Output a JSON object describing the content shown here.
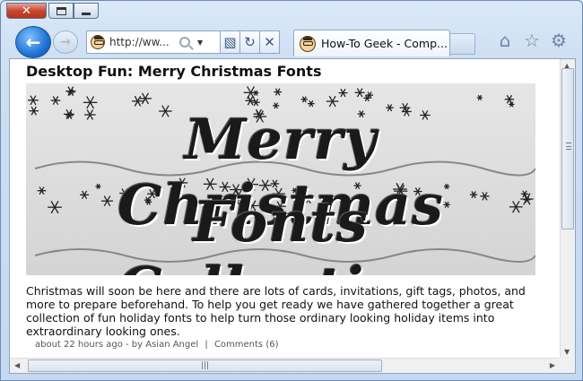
{
  "window": {
    "close_glyph": "✕"
  },
  "nav": {
    "back_glyph": "←",
    "forward_glyph": "→"
  },
  "address": {
    "url": "http://ww..."
  },
  "address_buttons": {
    "compat_glyph": "▧",
    "refresh_glyph": "↻",
    "stop_glyph": "✕",
    "dropdown_glyph": "▼"
  },
  "tab": {
    "title": "How-To Geek - Comp..."
  },
  "tools": {
    "home_glyph": "⌂",
    "favorites_glyph": "☆",
    "settings_glyph": "⚙"
  },
  "article": {
    "title": "Desktop Fun: Merry Christmas Fonts",
    "banner_line1": "Merry Christmas",
    "banner_line2": "Fonts Collection",
    "excerpt": "Christmas will soon be here and there are lots of cards, invitations, gift tags, photos, and more to prepare beforehand. To help you get ready we have gathered together a great collection of fun holiday fonts to help turn those ordinary looking holiday items into extraordinary looking ones.",
    "meta_time": "about 22 hours ago",
    "meta_by": "- by Asian Angel",
    "meta_separator": "|",
    "meta_comments": "Comments (6)"
  },
  "scrollbars": {
    "up_glyph": "▲",
    "down_glyph": "▼",
    "left_glyph": "◀",
    "right_glyph": "▶",
    "h_grip": "|||"
  }
}
